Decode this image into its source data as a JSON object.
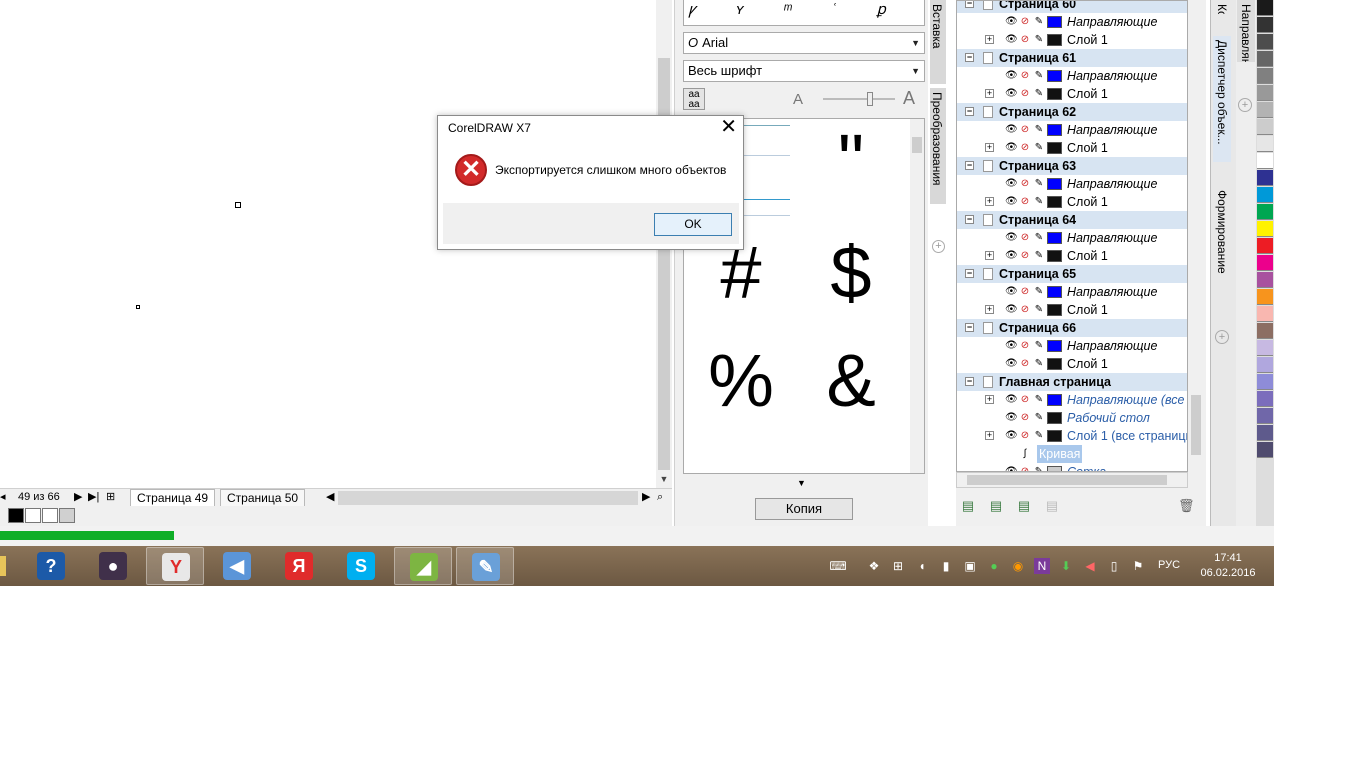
{
  "dialog": {
    "title": "CorelDRAW X7",
    "message": "Экспортируется слишком много объектов",
    "ok": "OK"
  },
  "pagenav": {
    "counter": "49 из 66",
    "tabs": [
      "Страница 49",
      "Страница 50"
    ]
  },
  "glyphs": {
    "font": "Arial",
    "subset": "Весь шрифт",
    "copy": "Копия",
    "chars": [
      "#",
      "$",
      "%",
      "&",
      "\""
    ]
  },
  "vtabs": {
    "glyphs": "Вставка символа",
    "transform": "Преобразования",
    "objmgr": "Диспетчер объек...",
    "shaping": "Формирование",
    "guides": "Направляющие",
    "contour": "Контур"
  },
  "tree": {
    "rows": [
      {
        "kind": "page",
        "label": "Страница 60"
      },
      {
        "kind": "layer",
        "label": "Направляющие",
        "style": "italic",
        "color": "#0000ff",
        "expand": false
      },
      {
        "kind": "layer",
        "label": "Слой 1",
        "style": "normal",
        "color": "#111111",
        "expand": true
      },
      {
        "kind": "page",
        "label": "Страница 61"
      },
      {
        "kind": "layer",
        "label": "Направляющие",
        "style": "italic",
        "color": "#0000ff",
        "expand": false
      },
      {
        "kind": "layer",
        "label": "Слой 1",
        "style": "normal",
        "color": "#111111",
        "expand": true
      },
      {
        "kind": "page",
        "label": "Страница 62"
      },
      {
        "kind": "layer",
        "label": "Направляющие",
        "style": "italic",
        "color": "#0000ff",
        "expand": false
      },
      {
        "kind": "layer",
        "label": "Слой 1",
        "style": "normal",
        "color": "#111111",
        "expand": true
      },
      {
        "kind": "page",
        "label": "Страница 63"
      },
      {
        "kind": "layer",
        "label": "Направляющие",
        "style": "italic",
        "color": "#0000ff",
        "expand": false
      },
      {
        "kind": "layer",
        "label": "Слой 1",
        "style": "normal",
        "color": "#111111",
        "expand": true
      },
      {
        "kind": "page",
        "label": "Страница 64"
      },
      {
        "kind": "layer",
        "label": "Направляющие",
        "style": "italic",
        "color": "#0000ff",
        "expand": false
      },
      {
        "kind": "layer",
        "label": "Слой 1",
        "style": "normal",
        "color": "#111111",
        "expand": true
      },
      {
        "kind": "page",
        "label": "Страница 65"
      },
      {
        "kind": "layer",
        "label": "Направляющие",
        "style": "italic",
        "color": "#0000ff",
        "expand": false
      },
      {
        "kind": "layer",
        "label": "Слой 1",
        "style": "normal",
        "color": "#111111",
        "expand": true
      },
      {
        "kind": "page",
        "label": "Страница 66"
      },
      {
        "kind": "layer",
        "label": "Направляющие",
        "style": "italic",
        "color": "#0000ff",
        "expand": false
      },
      {
        "kind": "layer",
        "label": "Слой 1",
        "style": "normal",
        "color": "#111111",
        "expand": false
      },
      {
        "kind": "page",
        "label": "Главная страница"
      },
      {
        "kind": "layer",
        "label": "Направляющие (все с",
        "style": "italic-blue",
        "color": "#0000ff",
        "expand": true
      },
      {
        "kind": "layer",
        "label": "Рабочий стол",
        "style": "italic-blue",
        "color": "#111111",
        "expand": false
      },
      {
        "kind": "layer",
        "label": "Слой 1 (все страницы",
        "style": "blue",
        "color": "#111111",
        "expand": true
      },
      {
        "kind": "object",
        "label": "Кривая"
      },
      {
        "kind": "layer",
        "label": "Сетка",
        "style": "italic-blue",
        "color": "#cccccc",
        "expand": false
      }
    ]
  },
  "palette": [
    "#1a1a1a",
    "#333333",
    "#4d4d4d",
    "#666666",
    "#808080",
    "#999999",
    "#b3b3b3",
    "#cccccc",
    "#e6e6e6",
    "#ffffff",
    "#2e3192",
    "#0099d8",
    "#00a651",
    "#fff200",
    "#ed1c24",
    "#ec008c",
    "#a8519f",
    "#f7941d",
    "#f9b7b0",
    "#8c6e63",
    "#c7b9e2",
    "#b0a7de",
    "#8e8cd8",
    "#7b6dbc",
    "#7067a9",
    "#5e5a8c",
    "#4f4b6e"
  ],
  "colorrow": [
    "#000000",
    "#ffffff",
    "#ffffff",
    "#d0d0d0"
  ],
  "taskbar": {
    "time": "17:41",
    "date": "06.02.2016",
    "lang": "РУС",
    "apps": [
      {
        "name": "help",
        "color": "#1c5aa8",
        "glyph": "?"
      },
      {
        "name": "media",
        "color": "#40304a",
        "glyph": "●"
      },
      {
        "name": "yandex-browser",
        "color": "#e8e8e8",
        "glyph": "Y"
      },
      {
        "name": "sound",
        "color": "#5b95d8",
        "glyph": "◀"
      },
      {
        "name": "yandex",
        "color": "#e02b2b",
        "glyph": "Я"
      },
      {
        "name": "skype",
        "color": "#00aff0",
        "glyph": "S"
      },
      {
        "name": "coreldraw",
        "color": "#7db542",
        "glyph": "◢"
      },
      {
        "name": "paint",
        "color": "#6aa0d8",
        "glyph": "✎"
      }
    ]
  }
}
